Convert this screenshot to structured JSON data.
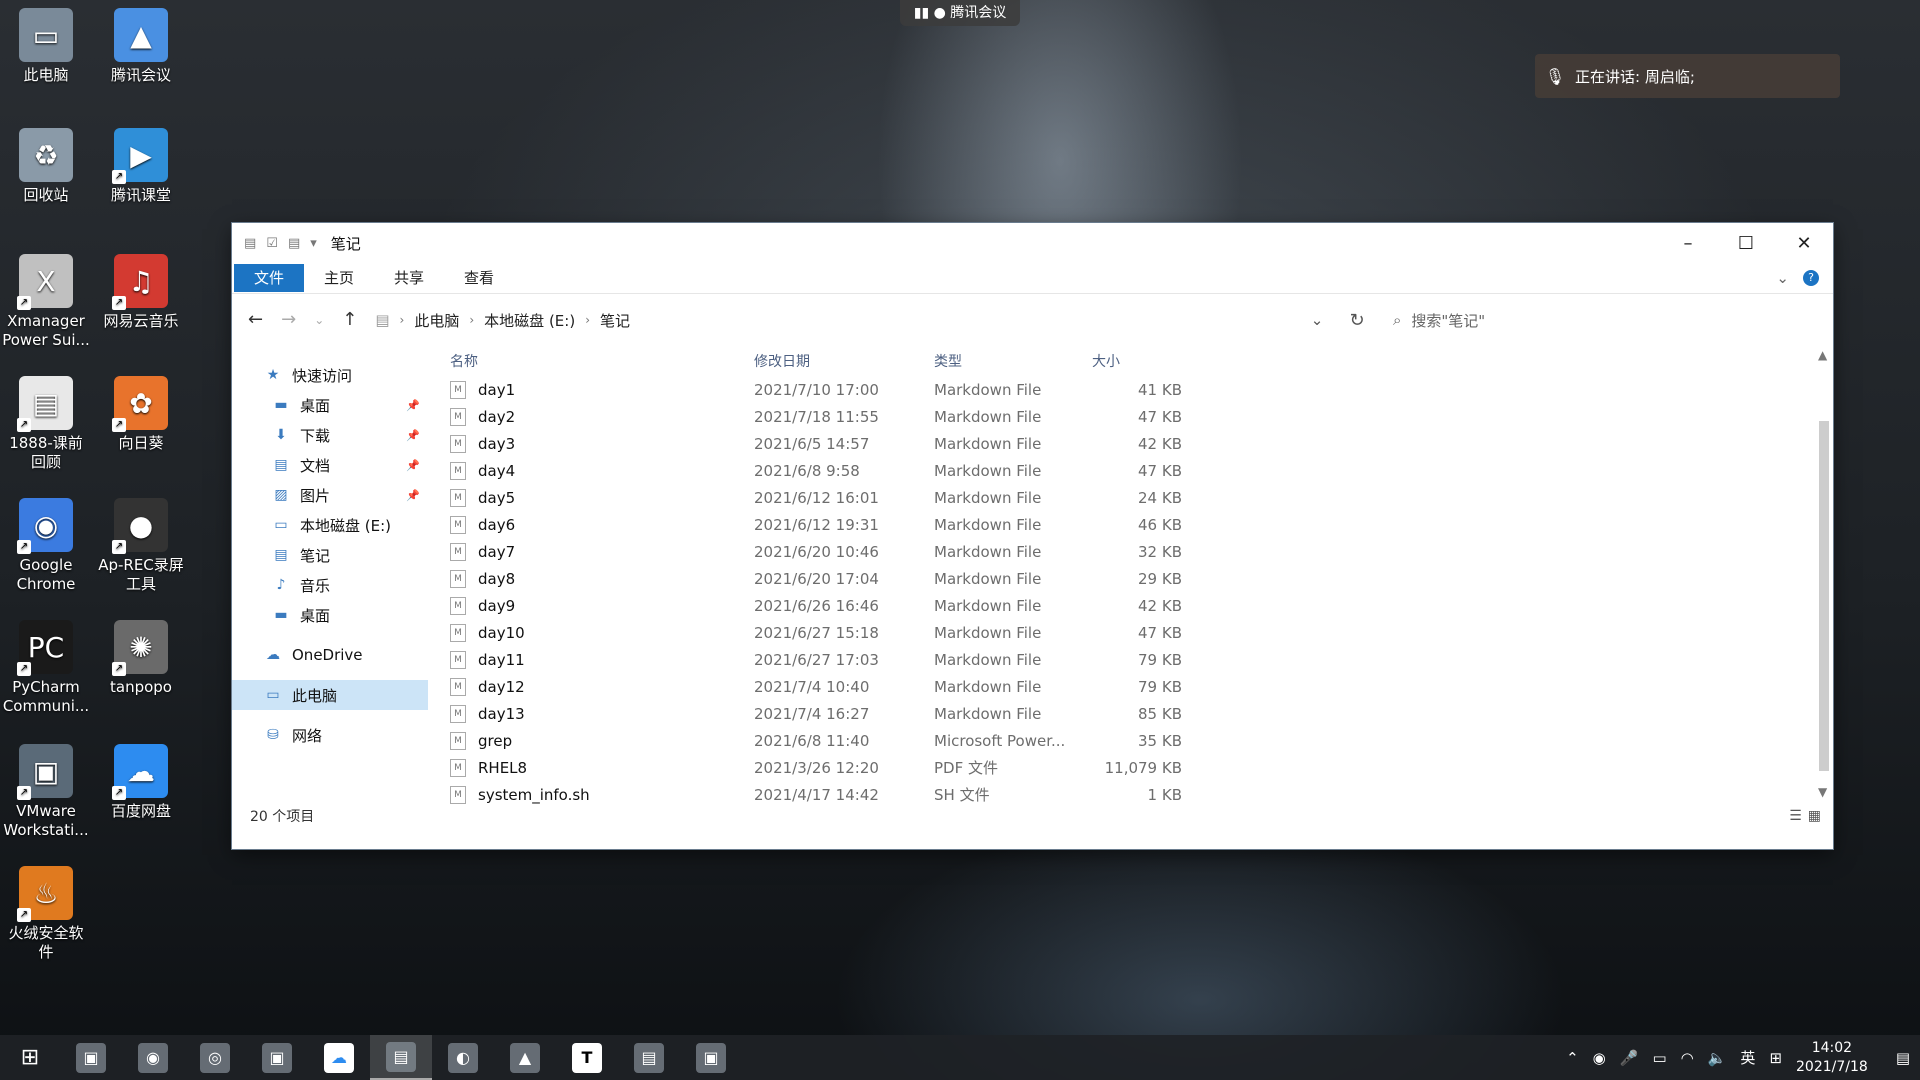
{
  "desktop": {
    "icons": [
      {
        "label": "此电脑",
        "icon": "computer-icon",
        "color": "#7a8a99"
      },
      {
        "label": "腾讯会议",
        "icon": "tencent-meeting-icon",
        "color": "#4a90e2"
      },
      {
        "label": "回收站",
        "icon": "recycle-bin-icon",
        "color": "#8a9aa8"
      },
      {
        "label": "腾讯课堂",
        "icon": "tencent-classroom-icon",
        "color": "#2f8fd8"
      },
      {
        "label": "Xmanager Power Sui...",
        "icon": "xmanager-icon",
        "color": "#c0c0c0"
      },
      {
        "label": "网易云音乐",
        "icon": "netease-music-icon",
        "color": "#d33a31"
      },
      {
        "label": "1888-课前回顾",
        "icon": "document-icon",
        "color": "#e8e8e8"
      },
      {
        "label": "向日葵",
        "icon": "sunflower-icon",
        "color": "#e8732c"
      },
      {
        "label": "Google Chrome",
        "icon": "chrome-icon",
        "color": "#3b7be0"
      },
      {
        "label": "Ap-REC录屏工具",
        "icon": "screen-recorder-icon",
        "color": "#333"
      },
      {
        "label": "PyCharm Communi...",
        "icon": "pycharm-icon",
        "color": "#1a1a1a"
      },
      {
        "label": "tanpopo",
        "icon": "tanpopo-icon",
        "color": "#6a6a6a"
      },
      {
        "label": "VMware Workstati...",
        "icon": "vmware-icon",
        "color": "#5a6a78"
      },
      {
        "label": "百度网盘",
        "icon": "baidu-netdisk-icon",
        "color": "#2d8cf0"
      },
      {
        "label": "火绒安全软件",
        "icon": "huorong-icon",
        "color": "#e07a1f"
      }
    ]
  },
  "meeting": {
    "pill": "腾讯会议",
    "speaking": "正在讲话: 周启临;"
  },
  "window": {
    "title": "笔记",
    "ribbon_tabs": [
      "文件",
      "主页",
      "共享",
      "查看"
    ],
    "help": "?",
    "breadcrumbs": [
      "此电脑",
      "本地磁盘 (E:)",
      "笔记"
    ],
    "search_placeholder": "搜索\"笔记\"",
    "nav": {
      "quick_access": "快速访问",
      "items": [
        {
          "label": "桌面",
          "icon": "desktop-folder-icon",
          "pinned": true
        },
        {
          "label": "下载",
          "icon": "download-icon",
          "pinned": true
        },
        {
          "label": "文档",
          "icon": "documents-icon",
          "pinned": true
        },
        {
          "label": "图片",
          "icon": "pictures-icon",
          "pinned": true
        },
        {
          "label": "本地磁盘 (E:)",
          "icon": "drive-icon",
          "pinned": false
        },
        {
          "label": "笔记",
          "icon": "folder-icon",
          "pinned": false
        },
        {
          "label": "音乐",
          "icon": "music-icon",
          "pinned": false
        },
        {
          "label": "桌面",
          "icon": "desktop-folder-icon",
          "pinned": false
        }
      ],
      "onedrive": "OneDrive",
      "this_pc": "此电脑",
      "network": "网络"
    },
    "columns": {
      "name": "名称",
      "date": "修改日期",
      "type": "类型",
      "size": "大小"
    },
    "files": [
      {
        "name": "day1",
        "date": "2021/7/10 17:00",
        "type": "Markdown File",
        "size": "41 KB"
      },
      {
        "name": "day2",
        "date": "2021/7/18 11:55",
        "type": "Markdown File",
        "size": "47 KB"
      },
      {
        "name": "day3",
        "date": "2021/6/5 14:57",
        "type": "Markdown File",
        "size": "42 KB"
      },
      {
        "name": "day4",
        "date": "2021/6/8 9:58",
        "type": "Markdown File",
        "size": "47 KB"
      },
      {
        "name": "day5",
        "date": "2021/6/12 16:01",
        "type": "Markdown File",
        "size": "24 KB"
      },
      {
        "name": "day6",
        "date": "2021/6/12 19:31",
        "type": "Markdown File",
        "size": "46 KB"
      },
      {
        "name": "day7",
        "date": "2021/6/20 10:46",
        "type": "Markdown File",
        "size": "32 KB"
      },
      {
        "name": "day8",
        "date": "2021/6/20 17:04",
        "type": "Markdown File",
        "size": "29 KB"
      },
      {
        "name": "day9",
        "date": "2021/6/26 16:46",
        "type": "Markdown File",
        "size": "42 KB"
      },
      {
        "name": "day10",
        "date": "2021/6/27 15:18",
        "type": "Markdown File",
        "size": "47 KB"
      },
      {
        "name": "day11",
        "date": "2021/6/27 17:03",
        "type": "Markdown File",
        "size": "79 KB"
      },
      {
        "name": "day12",
        "date": "2021/7/4 10:40",
        "type": "Markdown File",
        "size": "79 KB"
      },
      {
        "name": "day13",
        "date": "2021/7/4 16:27",
        "type": "Markdown File",
        "size": "85 KB"
      },
      {
        "name": "grep",
        "date": "2021/6/8 11:40",
        "type": "Microsoft Power...",
        "size": "35 KB"
      },
      {
        "name": "RHEL8",
        "date": "2021/3/26 12:20",
        "type": "PDF 文件",
        "size": "11,079 KB"
      },
      {
        "name": "system_info.sh",
        "date": "2021/4/17 14:42",
        "type": "SH 文件",
        "size": "1 KB"
      }
    ],
    "status": "20 个项目"
  },
  "taskbar": {
    "apps": [
      "vm-app-icon",
      "chrome-icon",
      "wechat-icon",
      "vmware-icon",
      "baidu-netdisk-icon",
      "file-explorer-icon",
      "terminal-icon",
      "tencent-meeting-icon",
      "typora-icon",
      "notepad-icon",
      "xshell-icon"
    ],
    "active_index": 5,
    "typora_glyph": "T",
    "ime": "英",
    "time": "14:02",
    "date": "2021/7/18"
  }
}
